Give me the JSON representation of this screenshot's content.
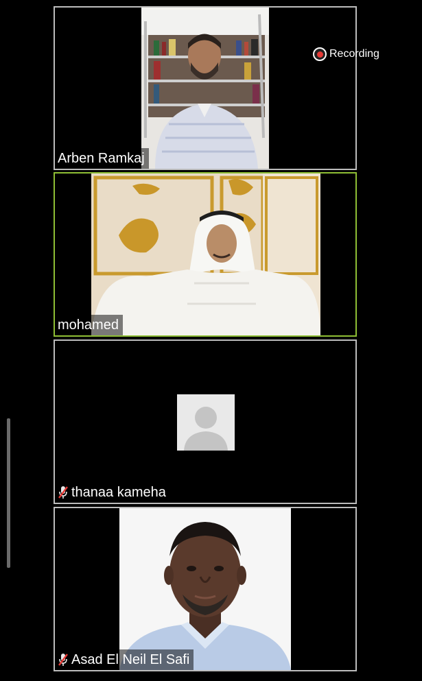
{
  "meeting": {
    "recording_label": "Recording"
  },
  "participants": [
    {
      "name": "Arben Ramkaj",
      "muted": false,
      "active_speaker": false,
      "has_video": true
    },
    {
      "name": "mohamed",
      "muted": false,
      "active_speaker": true,
      "has_video": true
    },
    {
      "name": "thanaa kameha",
      "muted": true,
      "active_speaker": false,
      "has_video": false
    },
    {
      "name": "Asad El Neil El Safi",
      "muted": true,
      "active_speaker": false,
      "has_video": true
    }
  ],
  "colors": {
    "active_speaker_border": "#8fbf35",
    "tile_border": "#bdbdbd",
    "recording_dot": "#e53935",
    "muted_mic": "#e53935"
  },
  "icons": {
    "recording": "recording-dot-icon",
    "muted": "mic-muted-icon",
    "no_video": "default-avatar-icon"
  }
}
